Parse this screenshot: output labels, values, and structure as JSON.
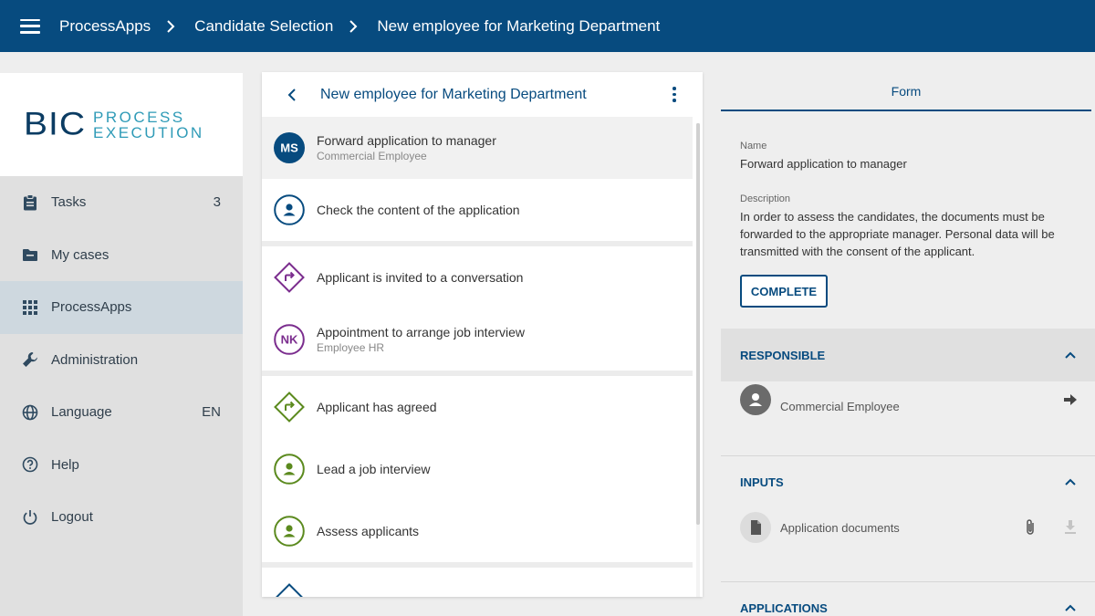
{
  "topbar": {
    "breadcrumbs": [
      "ProcessApps",
      "Candidate Selection",
      "New employee for Marketing Department"
    ]
  },
  "logo": {
    "bic": "BIC",
    "line1": "PROCESS",
    "line2": "EXECUTION"
  },
  "sidebar": {
    "items": [
      {
        "label": "Tasks",
        "badge": "3",
        "icon": "clipboard-icon"
      },
      {
        "label": "My cases",
        "badge": "",
        "icon": "folder-icon"
      },
      {
        "label": "ProcessApps",
        "badge": "",
        "icon": "apps-grid-icon",
        "active": true
      },
      {
        "label": "Administration",
        "badge": "",
        "icon": "wrench-icon"
      },
      {
        "label": "Language",
        "badge": "EN",
        "icon": "globe-icon"
      },
      {
        "label": "Help",
        "badge": "",
        "icon": "help-icon"
      },
      {
        "label": "Logout",
        "badge": "",
        "icon": "power-icon"
      }
    ]
  },
  "middle": {
    "title": "New employee for Marketing Department",
    "tasks": [
      {
        "title": "Forward application to manager",
        "sub": "Commercial Employee",
        "initials": "MS",
        "kind": "avatar-filled",
        "color": "#074b7f",
        "selected": true
      },
      {
        "title": "Check the content of the application",
        "sub": "",
        "kind": "person-outline",
        "color": "#074b7f"
      },
      {
        "title": "Applicant is invited to a conversation",
        "sub": "",
        "kind": "diamond",
        "color": "#7b2d8e"
      },
      {
        "title": "Appointment to arrange job interview",
        "sub": "Employee HR",
        "initials": "NK",
        "kind": "initials-outline",
        "color": "#7b2d8e"
      },
      {
        "title": "Applicant has agreed",
        "sub": "",
        "kind": "diamond",
        "color": "#5b8a1e"
      },
      {
        "title": "Lead a job interview",
        "sub": "",
        "kind": "person-outline",
        "color": "#5b8a1e"
      },
      {
        "title": "Assess applicants",
        "sub": "",
        "kind": "person-outline",
        "color": "#5b8a1e"
      }
    ]
  },
  "right": {
    "tab": "Form",
    "name_label": "Name",
    "name_value": "Forward application to manager",
    "desc_label": "Description",
    "desc_value": "In order to assess the candidates, the documents must be forwarded to the appropriate manager. Personal data will be transmitted with the consent of the applicant.",
    "complete_label": "COMPLETE",
    "responsible": {
      "heading": "RESPONSIBLE",
      "name": "Commercial Employee"
    },
    "inputs": {
      "heading": "INPUTS",
      "doc": "Application documents"
    },
    "applications": {
      "heading": "APPLICATIONS"
    }
  },
  "colors": {
    "primary": "#074b7f",
    "purple": "#7b2d8e",
    "green": "#5b8a1e",
    "logo_accent": "#2f9bb7"
  }
}
